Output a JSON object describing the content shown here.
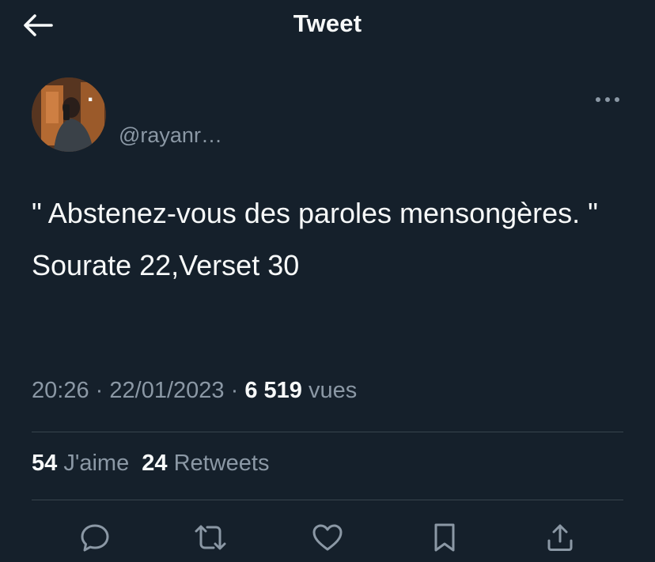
{
  "header": {
    "title": "Tweet",
    "back_icon": "arrow-left-icon"
  },
  "author": {
    "display_name": ".",
    "handle": "@rayanr…"
  },
  "tweet": {
    "text_line1": "\" Abstenez-vous des paroles mensongères. \"",
    "text_line2": "Sourate 22,Verset 30"
  },
  "meta": {
    "time": "20:26",
    "separator": "·",
    "date": "22/01/2023",
    "views_count": "6 519",
    "views_label": "vues"
  },
  "stats": {
    "likes_count": "54",
    "likes_label": "J'aime",
    "retweets_count": "24",
    "retweets_label": "Retweets"
  },
  "actions": [
    "reply-icon",
    "retweet-icon",
    "like-icon",
    "bookmark-icon",
    "share-icon"
  ],
  "colors": {
    "background": "#15202b",
    "text": "#f7f9f9",
    "secondary": "#8b98a5",
    "divider": "#38444d"
  }
}
